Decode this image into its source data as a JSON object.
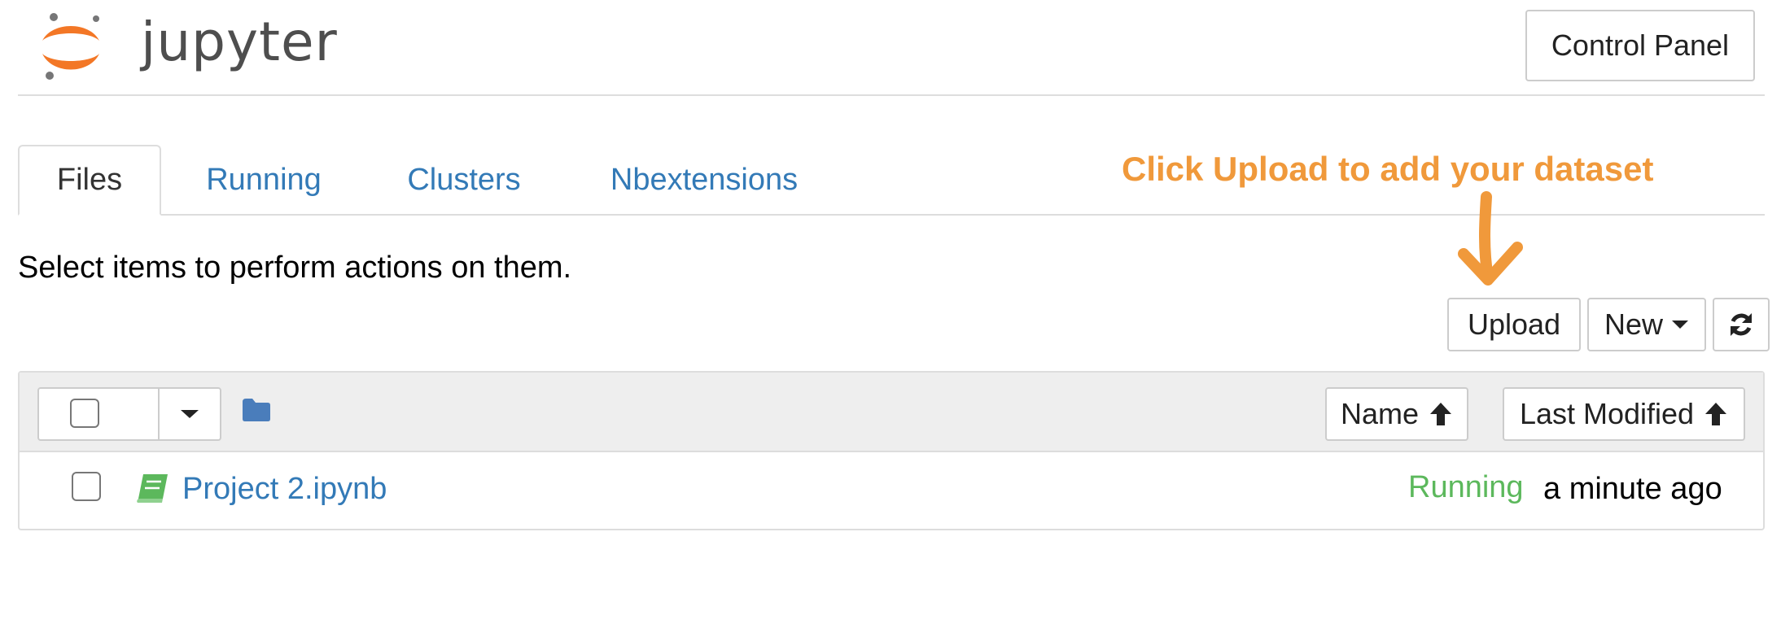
{
  "header": {
    "logo_text": "jupyter",
    "control_panel_label": "Control Panel"
  },
  "tabs": [
    {
      "label": "Files",
      "active": true
    },
    {
      "label": "Running",
      "active": false
    },
    {
      "label": "Clusters",
      "active": false
    },
    {
      "label": "Nbextensions",
      "active": false
    }
  ],
  "annotation": {
    "text": "Click Upload to add your dataset",
    "color": "#f0993b"
  },
  "instructions": "Select items to perform actions on them.",
  "toolbar": {
    "upload_label": "Upload",
    "new_label": "New",
    "refresh_icon": "refresh-icon"
  },
  "list": {
    "sort_name_label": "Name",
    "sort_modified_label": "Last Modified",
    "rows": [
      {
        "name": "Project 2.ipynb",
        "status": "Running",
        "modified": "a minute ago",
        "icon": "notebook-icon"
      }
    ]
  },
  "colors": {
    "link": "#337ab7",
    "running": "#5cb85c",
    "logo_orange": "#f37726",
    "header_bg": "#eeeeee"
  }
}
